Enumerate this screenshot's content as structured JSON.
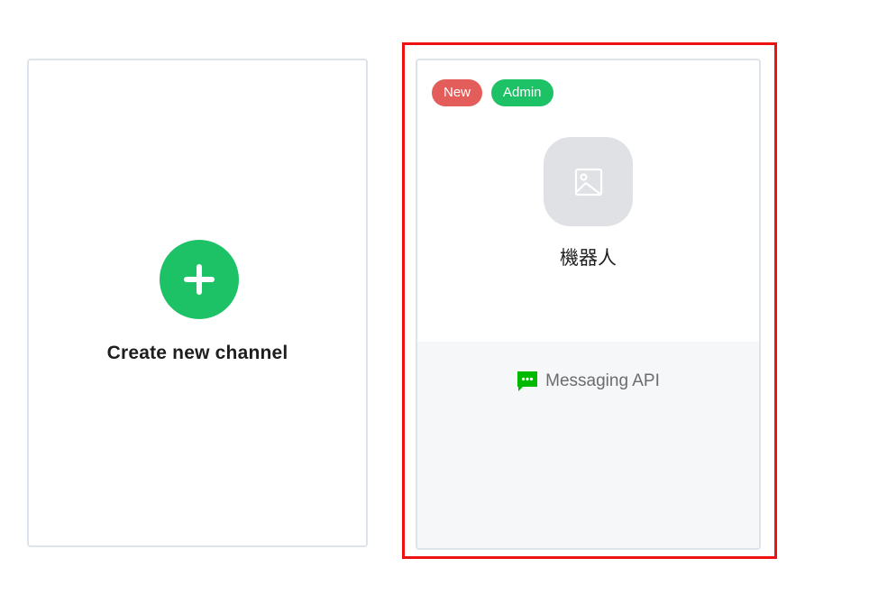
{
  "create_card": {
    "label": "Create new channel",
    "icon": "plus-icon",
    "accent_color": "#1ec266"
  },
  "channel_card": {
    "badges": [
      {
        "label": "New",
        "color": "#e35d5a"
      },
      {
        "label": "Admin",
        "color": "#1ec266"
      }
    ],
    "avatar_icon": "image-placeholder-icon",
    "name": "機器人",
    "type_label": "Messaging API",
    "type_icon": "chat-bubble-icon",
    "type_icon_color": "#00b900",
    "highlight_color": "#ee1111"
  }
}
